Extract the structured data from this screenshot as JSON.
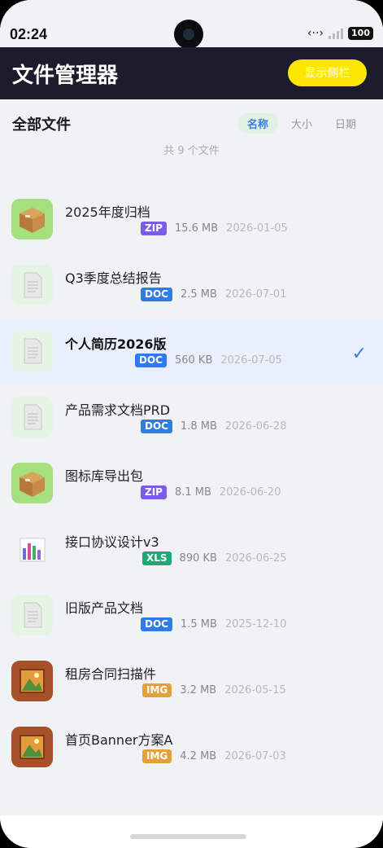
{
  "status": {
    "time": "02:24",
    "battery": "100"
  },
  "header": {
    "title": "文件管理器",
    "sidebar_button": "显示侧栏"
  },
  "toolbar": {
    "section_title": "全部文件",
    "sort_tabs": [
      {
        "label": "名称"
      },
      {
        "label": "大小"
      },
      {
        "label": "日期"
      }
    ],
    "count_text": "共 9 个文件"
  },
  "files": [
    {
      "name": "2025年度归档",
      "type": "ZIP",
      "size": "15.6 MB",
      "date": "2026-01-05"
    },
    {
      "name": "Q3季度总结报告",
      "type": "DOC",
      "size": "2.5 MB",
      "date": "2026-07-01"
    },
    {
      "name": "个人简历2026版",
      "type": "DOC",
      "size": "560 KB",
      "date": "2026-07-05"
    },
    {
      "name": "产品需求文档PRD",
      "type": "DOC",
      "size": "1.8 MB",
      "date": "2026-06-28"
    },
    {
      "name": "图标库导出包",
      "type": "ZIP",
      "size": "8.1 MB",
      "date": "2026-06-20"
    },
    {
      "name": "接口协议设计v3",
      "type": "XLS",
      "size": "890 KB",
      "date": "2026-06-25"
    },
    {
      "name": "旧版产品文档",
      "type": "DOC",
      "size": "1.5 MB",
      "date": "2025-12-10"
    },
    {
      "name": "租房合同扫描件",
      "type": "IMG",
      "size": "3.2 MB",
      "date": "2026-05-15"
    },
    {
      "name": "首页Banner方案A",
      "type": "IMG",
      "size": "4.2 MB",
      "date": "2026-07-03"
    }
  ],
  "colors": {
    "ZIP": "#7b5ce6",
    "DOC": "#2f7be8",
    "XLS": "#1fa877",
    "IMG": "#e3a13b",
    "accent": "#3a7de0",
    "header_bg": "#1c1c2c",
    "sidebar_button_bg": "#ffe600"
  },
  "selected_index": 2,
  "selected_mark": "✓"
}
